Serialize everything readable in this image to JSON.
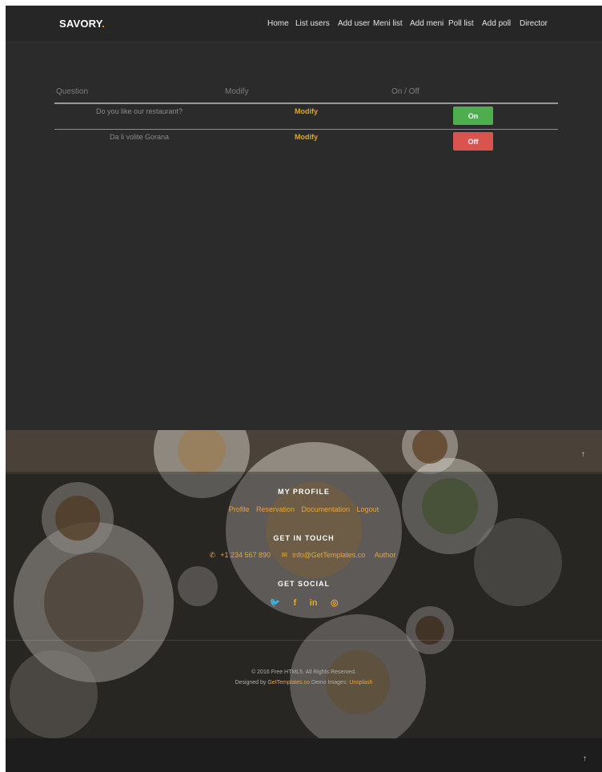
{
  "brand": {
    "name": "SAVORY",
    "dot": "."
  },
  "nav": [
    "Home",
    "List users",
    "Add user",
    "Meni list",
    "Add meni",
    "Poll list",
    "Add poll",
    "Director"
  ],
  "table": {
    "headers": {
      "question": "Question",
      "modify": "Modify",
      "onoff": "On / Off"
    },
    "rows": [
      {
        "question": "Do you like our restaurant?",
        "modify": "Modify",
        "status": "On"
      },
      {
        "question": "Da li volite Gorana",
        "modify": "Modify",
        "status": "Off"
      }
    ]
  },
  "footer": {
    "profile_title": "MY PROFILE",
    "profile_links": [
      "Profile",
      "Reservation",
      "Documentation",
      "Logout"
    ],
    "contact_title": "GET IN TOUCH",
    "phone": "+1 234 567 890",
    "email": "info@GetTemplates.co",
    "author": "Author",
    "social_title": "GET SOCIAL",
    "social_icons": [
      "twitter-icon",
      "facebook-icon",
      "linkedin-icon",
      "dribbble-icon"
    ],
    "copyright": "© 2016 Free HTML5. All Rights Reserved.",
    "designed_prefix": "Designed by",
    "designed_link": "GetTemplates.co",
    "demo_text": "Demo Images:",
    "demo_link": "Unsplash"
  },
  "to_top": "↑",
  "colors": {
    "accent": "#e8a63b",
    "on": "#4cae4c",
    "off": "#d9534f",
    "bg": "#2b2b2b"
  }
}
